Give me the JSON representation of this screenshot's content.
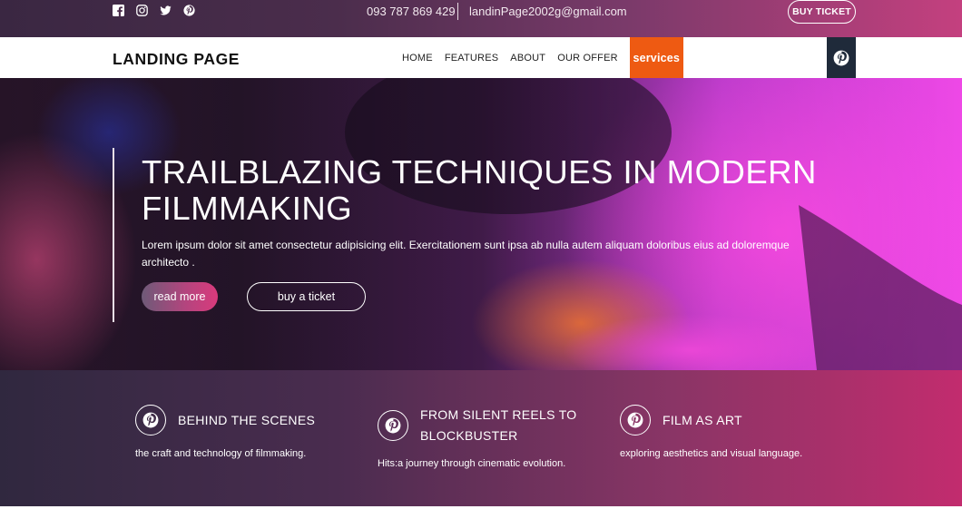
{
  "topbar": {
    "social": [
      {
        "icon": "facebook-icon"
      },
      {
        "icon": "instagram-icon"
      },
      {
        "icon": "twitter-icon"
      },
      {
        "icon": "pinterest-icon"
      }
    ],
    "phone": "093 787 869 429",
    "email": "landinPage2002g@gmail.com",
    "buy_ticket": "BUY TICKET"
  },
  "nav": {
    "logo": "LANDING PAGE",
    "items": [
      {
        "label": "HOME"
      },
      {
        "label": "FEATURES"
      },
      {
        "label": "ABOUT"
      },
      {
        "label": "OUR OFFER"
      },
      {
        "label": "services",
        "active": true
      }
    ],
    "pin_icon": "pinterest-icon"
  },
  "hero": {
    "title": "TRAILBLAZING TECHNIQUES IN MODERN FILMMAKING",
    "text": "Lorem ipsum dolor sit amet consectetur adipisicing elit. Exercitationem sunt ipsa ab nulla autem aliquam doloribus eius ad doloremque architecto .",
    "read_more": "read more",
    "buy_ticket": "buy a ticket"
  },
  "features": [
    {
      "icon": "pinterest-icon",
      "title": "BEHIND THE SCENES",
      "desc": "the craft and technology of filmmaking."
    },
    {
      "icon": "pinterest-icon",
      "title": "FROM SILENT REELS TO BLOCKBUSTER",
      "desc": "Hits:a journey through cinematic evolution."
    },
    {
      "icon": "pinterest-icon",
      "title": "FILM AS ART",
      "desc": "exploring aesthetics and visual language."
    }
  ],
  "colors": {
    "accent": "#ee5a12",
    "pink": "#d93a7c",
    "nav_dark": "#1f2a3a"
  }
}
